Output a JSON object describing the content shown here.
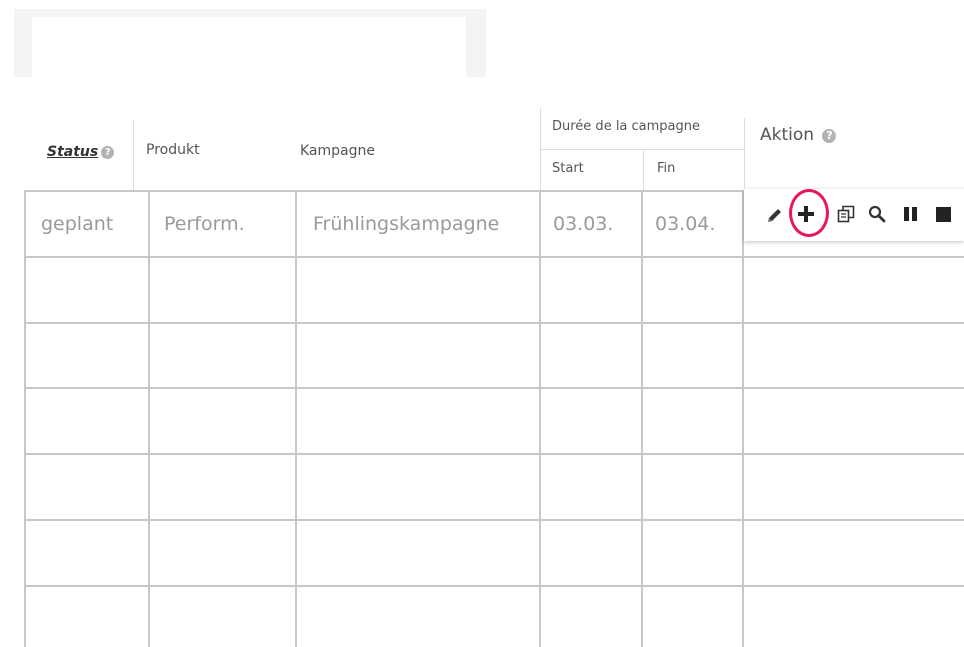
{
  "header": {
    "status": "Status",
    "produkt": "Produkt",
    "kampagne": "Kampagne",
    "duree": "Durée de la campagne",
    "start": "Start",
    "fin": "Fin",
    "aktion": "Aktion",
    "help": "?"
  },
  "rows": [
    {
      "status": "geplant",
      "produkt": "Perform.",
      "kampagne": "Frühlingskampagne",
      "start": "03.03.",
      "fin": "03.04."
    }
  ],
  "toolbar": {
    "icons": [
      "pencil-icon",
      "plus-icon",
      "copy-icon",
      "search-icon",
      "pause-icon",
      "stop-icon"
    ],
    "highlighted": "plus-icon"
  },
  "colors": {
    "highlight": "#e8175d",
    "grid": "#c8c8c8"
  }
}
